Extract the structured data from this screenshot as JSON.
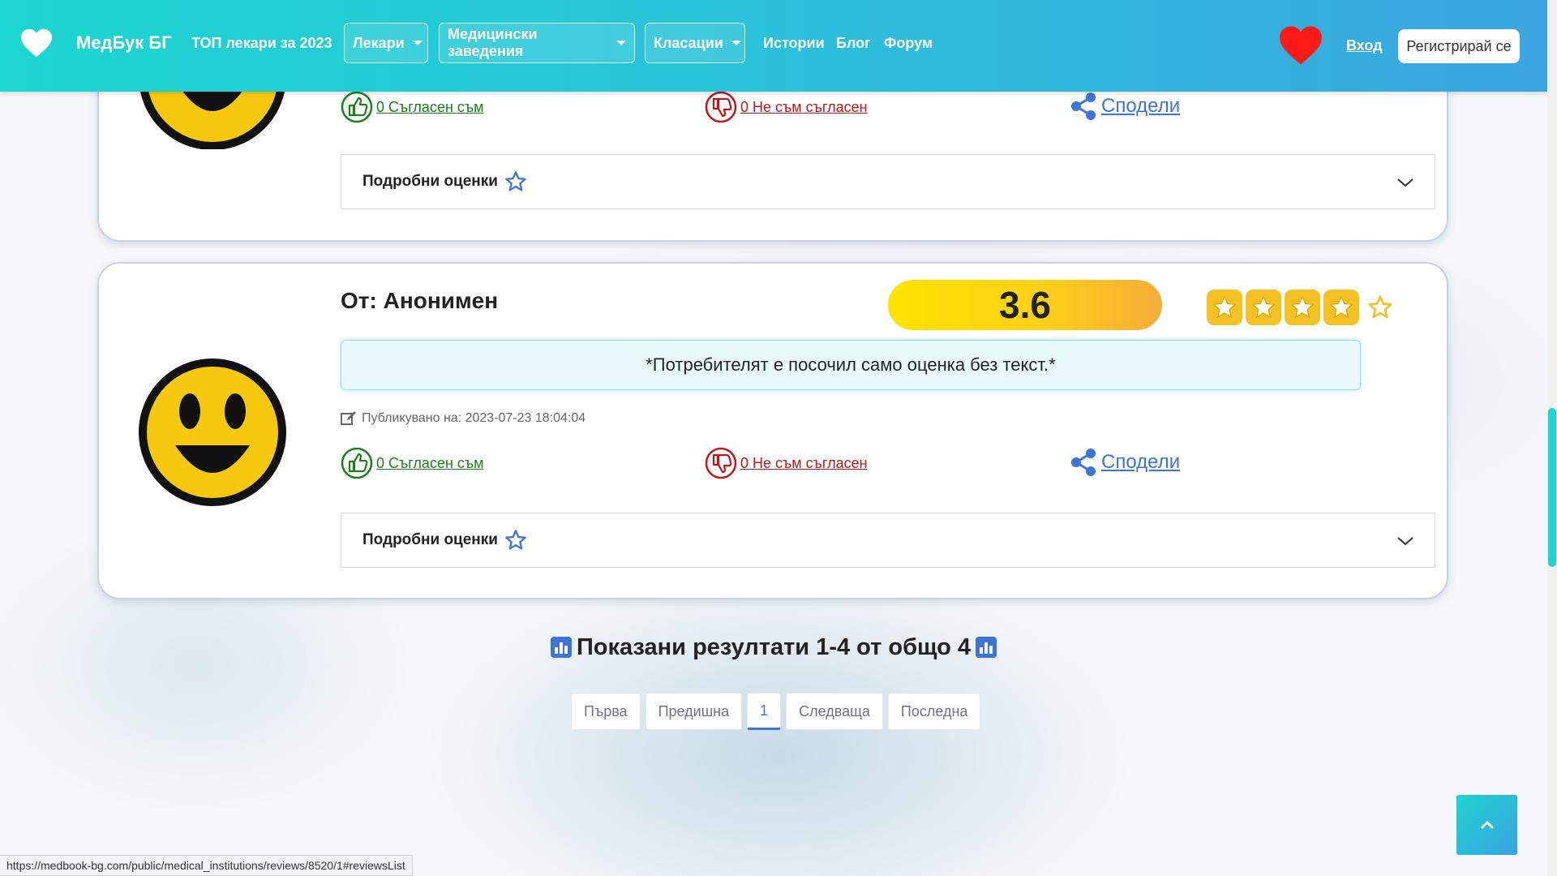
{
  "nav": {
    "brand": "МедБук БГ",
    "top_doctors": "ТОП лекари за 2023",
    "dropdowns": [
      "Лекари",
      "Медицински заведения",
      "Класации"
    ],
    "links": [
      "Истории",
      "Блог",
      "Форум"
    ],
    "login": "Вход",
    "register": "Регистрирай се"
  },
  "review_prev": {
    "agree": "0 Съгласен съм",
    "disagree": "0 Не съм съгласен",
    "share": "Сподели",
    "details": "Подробни оценки"
  },
  "review": {
    "author": "От: Анонимен",
    "score": "3.6",
    "stars_filled": 4,
    "stars_total": 5,
    "text": "*Потребителят е посочил само оценка без текст.*",
    "published": "Публикувано на: 2023-07-23 18:04:04",
    "agree": "0 Съгласен съм",
    "disagree": "0 Не съм съгласен",
    "share": "Сподели",
    "details": "Подробни оценки"
  },
  "results": "Показани резултати 1-4 от общо 4",
  "pagination": {
    "first": "Първа",
    "prev": "Предишна",
    "current": "1",
    "next": "Следваща",
    "last": "Последна"
  },
  "status_url": "https://medbook-bg.com/public/medical_institutions/reviews/8520/1#reviewsList",
  "colors": {
    "nav_gradient_start": "#1cd6d0",
    "nav_gradient_end": "#3aa6e0",
    "agree": "#1a7f1a",
    "disagree": "#c0161a",
    "share": "#3d75d6",
    "score_pill": "#ffd118",
    "star": "#f6c223"
  }
}
